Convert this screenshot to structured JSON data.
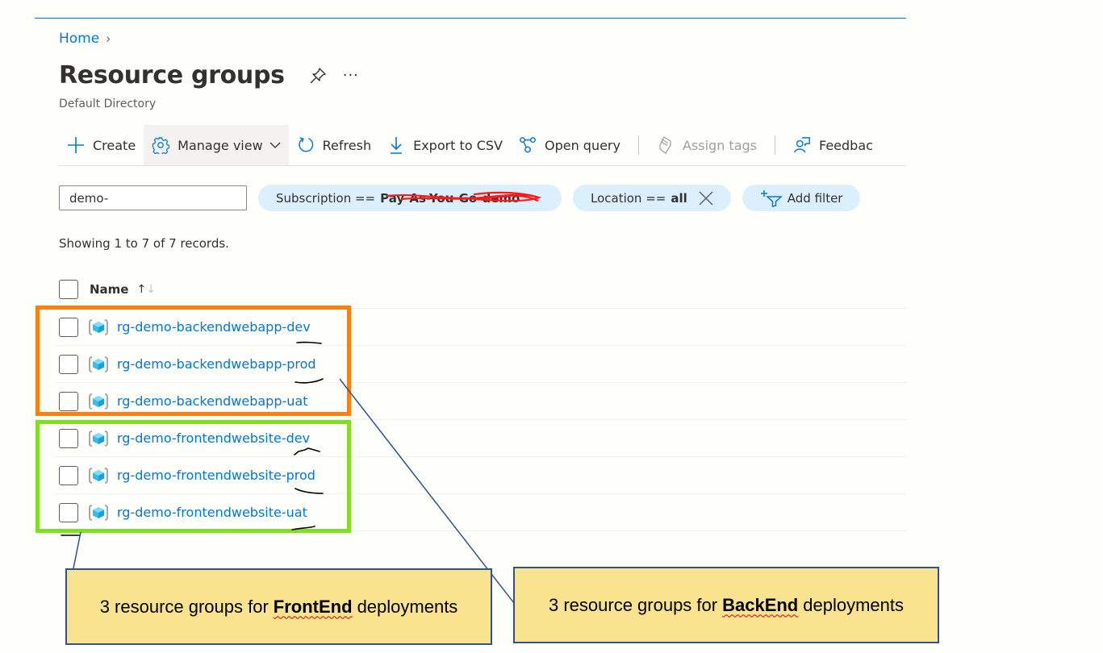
{
  "breadcrumb": {
    "home": "Home",
    "separator": "›"
  },
  "header": {
    "title": "Resource groups",
    "subtitle": "Default Directory",
    "more_label": "···"
  },
  "toolbar": {
    "create": "Create",
    "manage_view": "Manage view",
    "refresh": "Refresh",
    "export_csv": "Export to CSV",
    "open_query": "Open query",
    "assign_tags": "Assign tags",
    "feedback": "Feedbac"
  },
  "filters": {
    "search_value": "demo-",
    "subscription_label": "Subscription ==",
    "subscription_value": "Pay-As-You-Go-demo",
    "location_label": "Location ==",
    "location_value": "all",
    "add_filter": "Add filter"
  },
  "records_text": "Showing 1 to 7 of 7 records.",
  "table": {
    "column_name": "Name",
    "sort_up": "↑",
    "sort_down": "↓",
    "rows": [
      {
        "name": "rg-demo-backendwebapp-dev"
      },
      {
        "name": "rg-demo-backendwebapp-prod"
      },
      {
        "name": "rg-demo-backendwebapp-uat"
      },
      {
        "name": "rg-demo-frontendwebsite-dev"
      },
      {
        "name": "rg-demo-frontendwebsite-prod"
      },
      {
        "name": "rg-demo-frontendwebsite-uat"
      }
    ]
  },
  "annotations": {
    "frontend": {
      "prefix": "3 resource groups for",
      "bold": "FrontEnd",
      "suffix": "deployments"
    },
    "backend": {
      "prefix": "3 resource groups for",
      "bold": "BackEnd",
      "suffix": "deployments"
    }
  },
  "colors": {
    "accent": "#0078d4",
    "backend_highlight": "#ff7f0e",
    "frontend_highlight": "#7ee021",
    "note_fill": "#f9e38e",
    "note_border": "#2f528f"
  }
}
